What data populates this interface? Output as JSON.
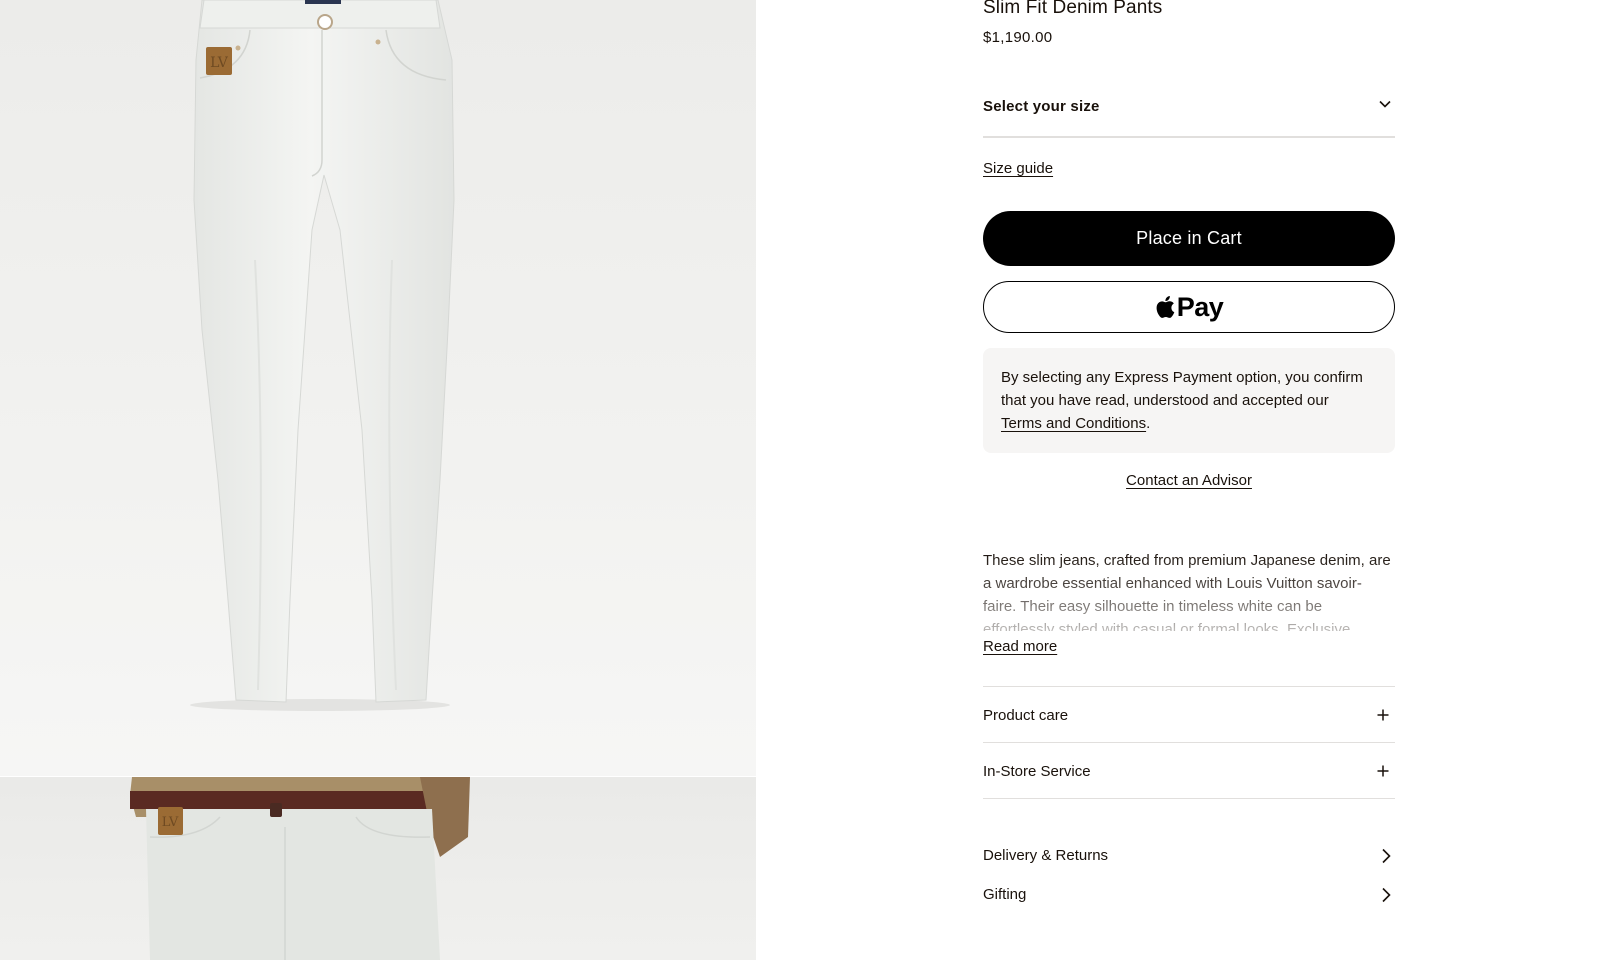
{
  "product": {
    "title": "Slim Fit Denim Pants",
    "price": "$1,190.00"
  },
  "size_select": {
    "label": "Select your size",
    "icon": "chevron-down-icon"
  },
  "size_guide_label": "Size guide",
  "cart_button_label": "Place in Cart",
  "apple_pay": {
    "label": "Pay",
    "icon": "apple-icon"
  },
  "express_notice": {
    "text": "By selecting any Express Payment option, you confirm that you have read, understood and accepted our ",
    "link": "Terms and Conditions",
    "suffix": "."
  },
  "contact_advisor_label": "Contact an Advisor",
  "description": {
    "text": "These slim jeans, crafted from premium Japanese denim, are a wardrobe essential enhanced with Louis Vuitton savoir-faire. Their easy silhouette in timeless white can be effortlessly styled with casual or formal looks. Exclusive details include signature stitching",
    "read_more": "Read more"
  },
  "accordions": [
    {
      "label": "Product care",
      "icon": "plus-icon"
    },
    {
      "label": "In-Store Service",
      "icon": "plus-icon"
    }
  ],
  "links": [
    {
      "label": "Delivery & Returns",
      "icon": "chevron-right-icon"
    },
    {
      "label": "Gifting",
      "icon": "chevron-right-icon"
    }
  ],
  "colors": {
    "text": "#19110b",
    "button_bg": "#000000",
    "notice_bg": "#f6f5f4",
    "divider": "#e1dfdd"
  }
}
